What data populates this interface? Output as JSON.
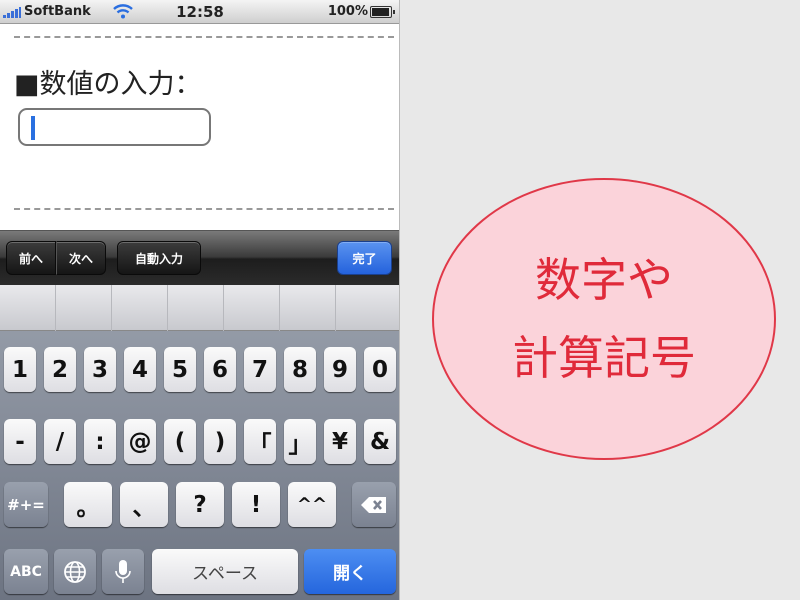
{
  "status_bar": {
    "carrier": "SoftBank",
    "time": "12:58",
    "battery_percent": "100%",
    "battery_level": 1.0
  },
  "form": {
    "label": "■数値の入力：",
    "input_value": ""
  },
  "toolbar": {
    "prev_label": "前へ",
    "next_label": "次へ",
    "autofill_label": "自動入力",
    "done_label": "完了"
  },
  "keyboard": {
    "row1": [
      "1",
      "2",
      "3",
      "4",
      "5",
      "6",
      "7",
      "8",
      "9",
      "0"
    ],
    "row2": [
      "-",
      "/",
      ":",
      "@",
      "(",
      ")",
      "「",
      "」",
      "¥",
      "&"
    ],
    "row3": [
      "#+=",
      "。",
      "、",
      "?",
      "!",
      "^^"
    ],
    "row4": {
      "abc": "ABC",
      "space": "スペース",
      "open": "開く"
    }
  },
  "icons": {
    "signal": "signal-bars-icon",
    "wifi": "wifi-icon",
    "battery": "battery-icon",
    "backspace": "backspace-icon",
    "globe": "globe-icon",
    "microphone": "microphone-icon"
  },
  "colors": {
    "accent_blue": "#2566dd",
    "badge_text": "#e02a3a",
    "badge_fill": "#fbd3da"
  },
  "badge": {
    "line1": "数字や",
    "line2": "計算記号"
  }
}
